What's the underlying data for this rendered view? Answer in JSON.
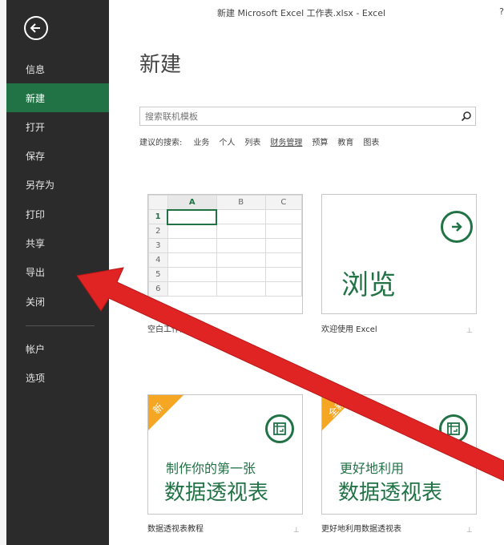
{
  "window": {
    "title": "新建 Microsoft Excel 工作表.xlsx - Excel",
    "help": "?"
  },
  "sidebar": {
    "items": [
      {
        "label": "信息",
        "active": false
      },
      {
        "label": "新建",
        "active": true
      },
      {
        "label": "打开",
        "active": false
      },
      {
        "label": "保存",
        "active": false
      },
      {
        "label": "另存为",
        "active": false
      },
      {
        "label": "打印",
        "active": false
      },
      {
        "label": "共享",
        "active": false
      },
      {
        "label": "导出",
        "active": false
      },
      {
        "label": "关闭",
        "active": false
      },
      {
        "label": "帐户",
        "active": false
      },
      {
        "label": "选项",
        "active": false
      }
    ]
  },
  "main": {
    "title": "新建",
    "search": {
      "placeholder": "搜索联机模板"
    },
    "suggested": {
      "label": "建议的搜索:",
      "items": [
        "业务",
        "个人",
        "列表",
        "财务管理",
        "预算",
        "教育",
        "图表"
      ]
    },
    "templates": [
      {
        "caption": "空白工作簿",
        "grid": {
          "columns": [
            "A",
            "B",
            "C"
          ],
          "rows": [
            "1",
            "2",
            "3",
            "4",
            "5",
            "6"
          ]
        }
      },
      {
        "caption": "欢迎使用 Excel",
        "big_text": "浏览"
      },
      {
        "caption": "数据透视表教程",
        "badge": "新",
        "line1": "制作你的第一张",
        "line2": "数据透视表"
      },
      {
        "caption": "更好地利用数据透视表",
        "badge": "全新",
        "line1": "更好地利用",
        "line2": "数据透视表"
      }
    ]
  },
  "colors": {
    "sidebar_bg": "#2b2b2b",
    "accent_green": "#217346",
    "badge_orange": "#f5a623",
    "arrow_red": "#e02424"
  },
  "icons": {
    "back": "back-arrow-icon",
    "search": "search-icon",
    "pin": "pin-icon",
    "browse": "arrow-right-circle-icon",
    "pivot": "pivot-table-icon"
  }
}
